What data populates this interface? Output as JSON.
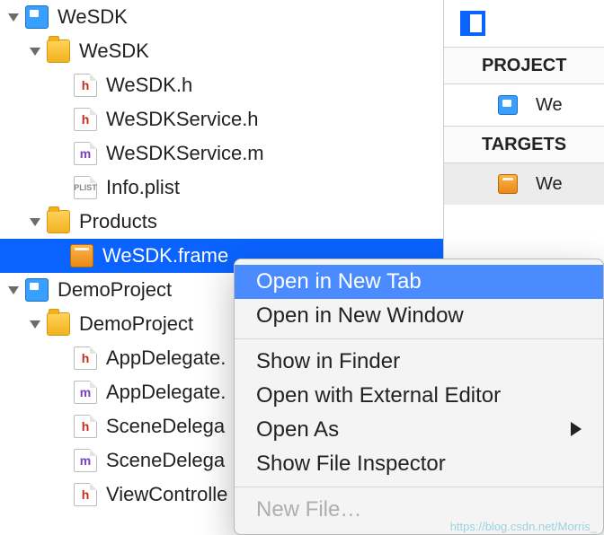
{
  "navigator": {
    "items": [
      {
        "kind": "project",
        "label": "WeSDK",
        "depth": 0,
        "expanded": true
      },
      {
        "kind": "folder",
        "label": "WeSDK",
        "depth": 1,
        "expanded": true
      },
      {
        "kind": "file_h",
        "label": "WeSDK.h",
        "depth": 2
      },
      {
        "kind": "file_h",
        "label": "WeSDKService.h",
        "depth": 2
      },
      {
        "kind": "file_m",
        "label": "WeSDKService.m",
        "depth": 2
      },
      {
        "kind": "plist",
        "label": "Info.plist",
        "depth": 2
      },
      {
        "kind": "folder",
        "label": "Products",
        "depth": 1,
        "expanded": true
      },
      {
        "kind": "framework",
        "label": "WeSDK.frame",
        "depth": 3,
        "selected": true
      },
      {
        "kind": "project",
        "label": "DemoProject",
        "depth": 0,
        "expanded": true
      },
      {
        "kind": "folder",
        "label": "DemoProject",
        "depth": 1,
        "expanded": true
      },
      {
        "kind": "file_h",
        "label": "AppDelegate.",
        "depth": 2
      },
      {
        "kind": "file_m",
        "label": "AppDelegate.",
        "depth": 2
      },
      {
        "kind": "file_h",
        "label": "SceneDelega",
        "depth": 2
      },
      {
        "kind": "file_m",
        "label": "SceneDelega",
        "depth": 2
      },
      {
        "kind": "file_h",
        "label": "ViewControlle",
        "depth": 2
      }
    ]
  },
  "editor": {
    "project_header": "PROJECT",
    "project_item": "We",
    "targets_header": "TARGETS",
    "target_item": "We"
  },
  "context_menu": {
    "items": [
      {
        "label": "Open in New Tab",
        "highlight": true
      },
      {
        "label": "Open in New Window"
      },
      {
        "sep": true
      },
      {
        "label": "Show in Finder"
      },
      {
        "label": "Open with External Editor"
      },
      {
        "label": "Open As",
        "submenu": true
      },
      {
        "label": "Show File Inspector"
      },
      {
        "sep": true
      },
      {
        "label": "New File…",
        "disabled": true
      }
    ]
  },
  "icon_glyphs": {
    "h": "h",
    "m": "m",
    "plist": "PLIST"
  },
  "watermark": "https://blog.csdn.net/Morris_"
}
